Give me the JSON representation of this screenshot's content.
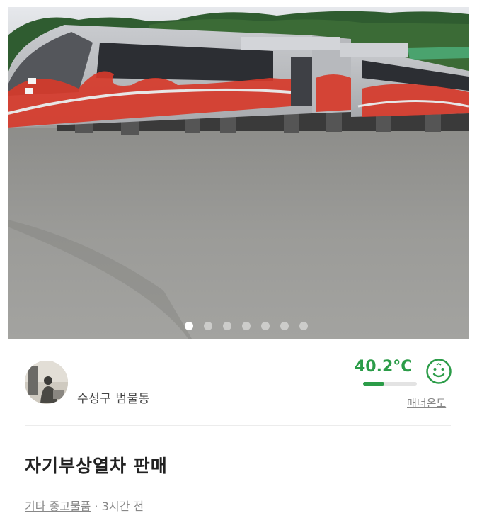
{
  "listing": {
    "photo": {
      "description_icon": "train-photo",
      "dot_count": 7,
      "active_index": 0
    },
    "seller": {
      "location": "수성구 범물동"
    },
    "manner": {
      "temperature": "40.2°C",
      "fill_fraction": 0.4,
      "label": "매너온도",
      "face_icon": "smiley-face-icon",
      "color": "#2b9c48"
    },
    "title": "자기부상열차 판매",
    "category": "기타 중고물품",
    "separator": " · ",
    "time_ago": "3시간 전"
  }
}
